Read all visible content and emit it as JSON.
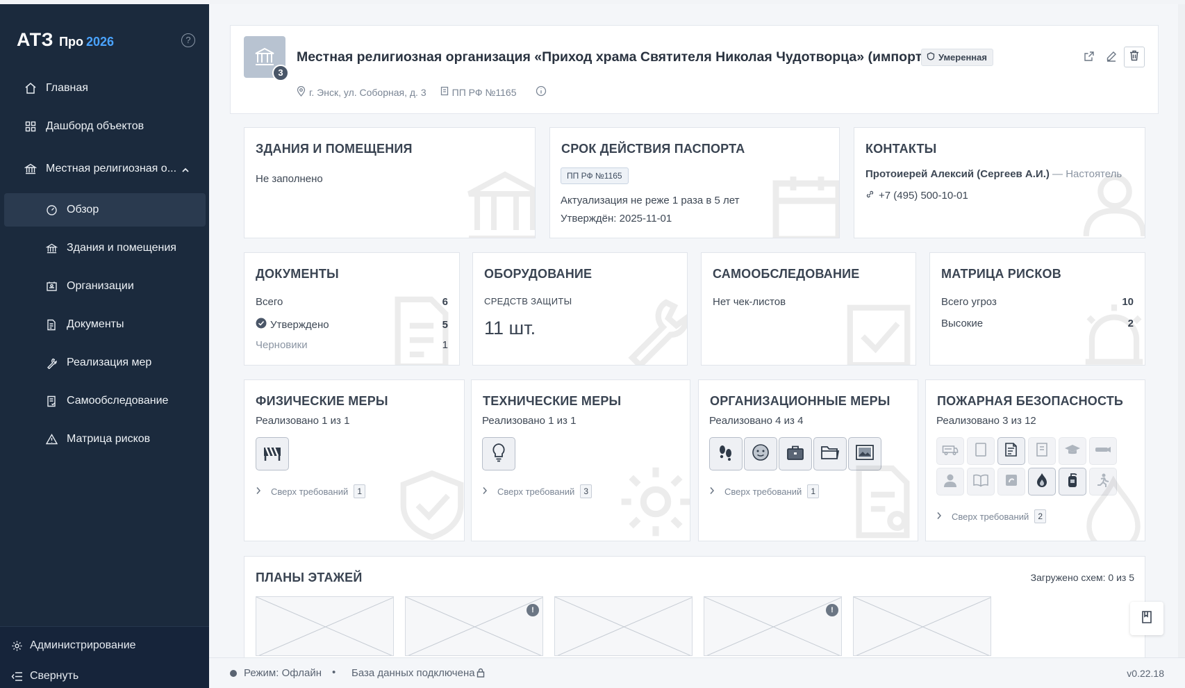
{
  "app": {
    "logo": "АТЗ",
    "edition": "Про",
    "year": "2026"
  },
  "sidebar": {
    "items": [
      {
        "label": "Главная",
        "icon": "home-icon"
      },
      {
        "label": "Дашборд объектов",
        "icon": "grid-icon"
      },
      {
        "label": "Местная религиозная о...",
        "icon": "building-icon"
      }
    ],
    "subitems": [
      {
        "label": "Обзор",
        "icon": "gauge-icon"
      },
      {
        "label": "Здания и помещения",
        "icon": "building-icon"
      },
      {
        "label": "Организации",
        "icon": "organization-icon"
      },
      {
        "label": "Документы",
        "icon": "document-icon"
      },
      {
        "label": "Реализация мер",
        "icon": "wrench-icon"
      },
      {
        "label": "Самообследование",
        "icon": "checklist-icon"
      },
      {
        "label": "Матрица рисков",
        "icon": "warning-icon"
      }
    ],
    "admin": "Администрирование",
    "collapse": "Свернуть"
  },
  "header": {
    "badge": "3",
    "title": "Местная религиозная организация «Приход храма Святителя Николая Чудотворца» (импорт)",
    "risk": "Умеренная",
    "address": "г. Энск, ул. Соборная, д. 3",
    "regulation": "ПП РФ №1165"
  },
  "buildings": {
    "title": "Здания и помещения",
    "empty": "Не заполнено"
  },
  "passport": {
    "title": "Срок действия паспорта",
    "tag": "ПП РФ №1165",
    "note": "Актуализация не реже 1 раза в 5 лет",
    "approved": "Утверждён: 2025-11-01"
  },
  "contacts": {
    "title": "Контакты",
    "name": "Протоиерей Алексий (Сергеев А.И.)",
    "dash": "—",
    "role": "Настоятель",
    "phone": "+7 (495) 500-10-01"
  },
  "documents": {
    "title": "Документы",
    "rows": [
      {
        "label": "Всего",
        "value": "6"
      },
      {
        "label": "Утверждено",
        "value": "5"
      },
      {
        "label": "Черновики",
        "value": "1"
      }
    ]
  },
  "equipment": {
    "title": "Оборудование",
    "sub": "Средств защиты",
    "value": "11 шт."
  },
  "selfcheck": {
    "title": "Самообследование",
    "empty": "Нет чек-листов"
  },
  "risks": {
    "title": "Матрица рисков",
    "rows": [
      {
        "label": "Всего угроз",
        "value": "10"
      },
      {
        "label": "Высокие",
        "value": "2"
      }
    ]
  },
  "measures": [
    {
      "title": "Физические меры",
      "status": "Реализовано 1 из 1",
      "above_label": "Сверх требований",
      "above_count": "1"
    },
    {
      "title": "Технические меры",
      "status": "Реализовано 1 из 1",
      "above_label": "Сверх требований",
      "above_count": "3"
    },
    {
      "title": "Организационные меры",
      "status": "Реализовано 4 из 4",
      "above_label": "Сверх требований",
      "above_count": "1"
    },
    {
      "title": "Пожарная безопасность",
      "status": "Реализовано 3 из 12",
      "above_label": "Сверх требований",
      "above_count": "2"
    }
  ],
  "floorplans": {
    "title": "Планы этажей",
    "status": "Загружено схем: 0 из 5",
    "alert_glyph": "!"
  },
  "statusbar": {
    "mode": "Режим: Офлайн",
    "sep": "•",
    "db": "База данных подключена",
    "version": "v0.22.18"
  },
  "colors": {
    "sidebar": "#1b2a3d",
    "accent": "#4aa3ff",
    "active": "#2a3a4f"
  }
}
